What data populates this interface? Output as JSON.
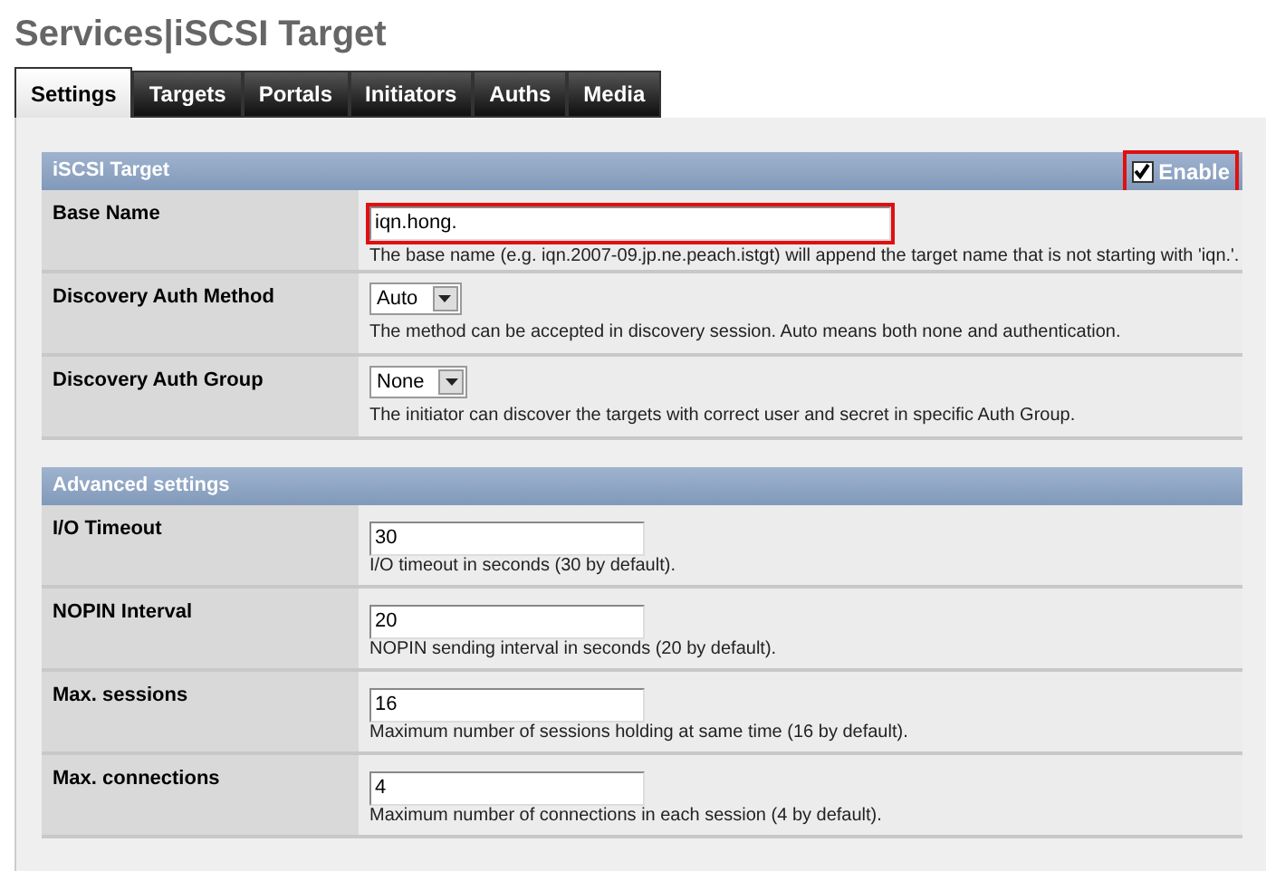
{
  "page_title": "Services|iSCSI Target",
  "tabs": [
    {
      "label": "Settings",
      "selected": true
    },
    {
      "label": "Targets",
      "selected": false
    },
    {
      "label": "Portals",
      "selected": false
    },
    {
      "label": "Initiators",
      "selected": false
    },
    {
      "label": "Auths",
      "selected": false
    },
    {
      "label": "Media",
      "selected": false
    }
  ],
  "sections": [
    {
      "title": "iSCSI Target",
      "enable": {
        "label": "Enable",
        "checked": true,
        "highlighted": true
      },
      "rows": [
        {
          "label": "Base Name",
          "kind": "text",
          "value": "iqn.hong.",
          "highlighted": true,
          "wide": true,
          "description": "The base name (e.g. iqn.2007-09.jp.ne.peach.istgt) will append the target name that is not starting with 'iqn.'."
        },
        {
          "label": "Discovery Auth Method",
          "kind": "select",
          "value": "Auto",
          "description": "The method can be accepted in discovery session. Auto means both none and authentication."
        },
        {
          "label": "Discovery Auth Group",
          "kind": "select",
          "value": "None",
          "description": "The initiator can discover the targets with correct user and secret in specific Auth Group."
        }
      ]
    },
    {
      "title": "Advanced settings",
      "rows": [
        {
          "label": "I/O Timeout",
          "kind": "text",
          "value": "30",
          "description": "I/O timeout in seconds (30 by default)."
        },
        {
          "label": "NOPIN Interval",
          "kind": "text",
          "value": "20",
          "description": "NOPIN sending interval in seconds (20 by default)."
        },
        {
          "label": "Max. sessions",
          "kind": "text",
          "value": "16",
          "description": "Maximum number of sessions holding at same time (16 by default)."
        },
        {
          "label": "Max. connections",
          "kind": "text",
          "value": "4",
          "description": "Maximum number of connections in each session (4 by default)."
        }
      ]
    }
  ]
}
